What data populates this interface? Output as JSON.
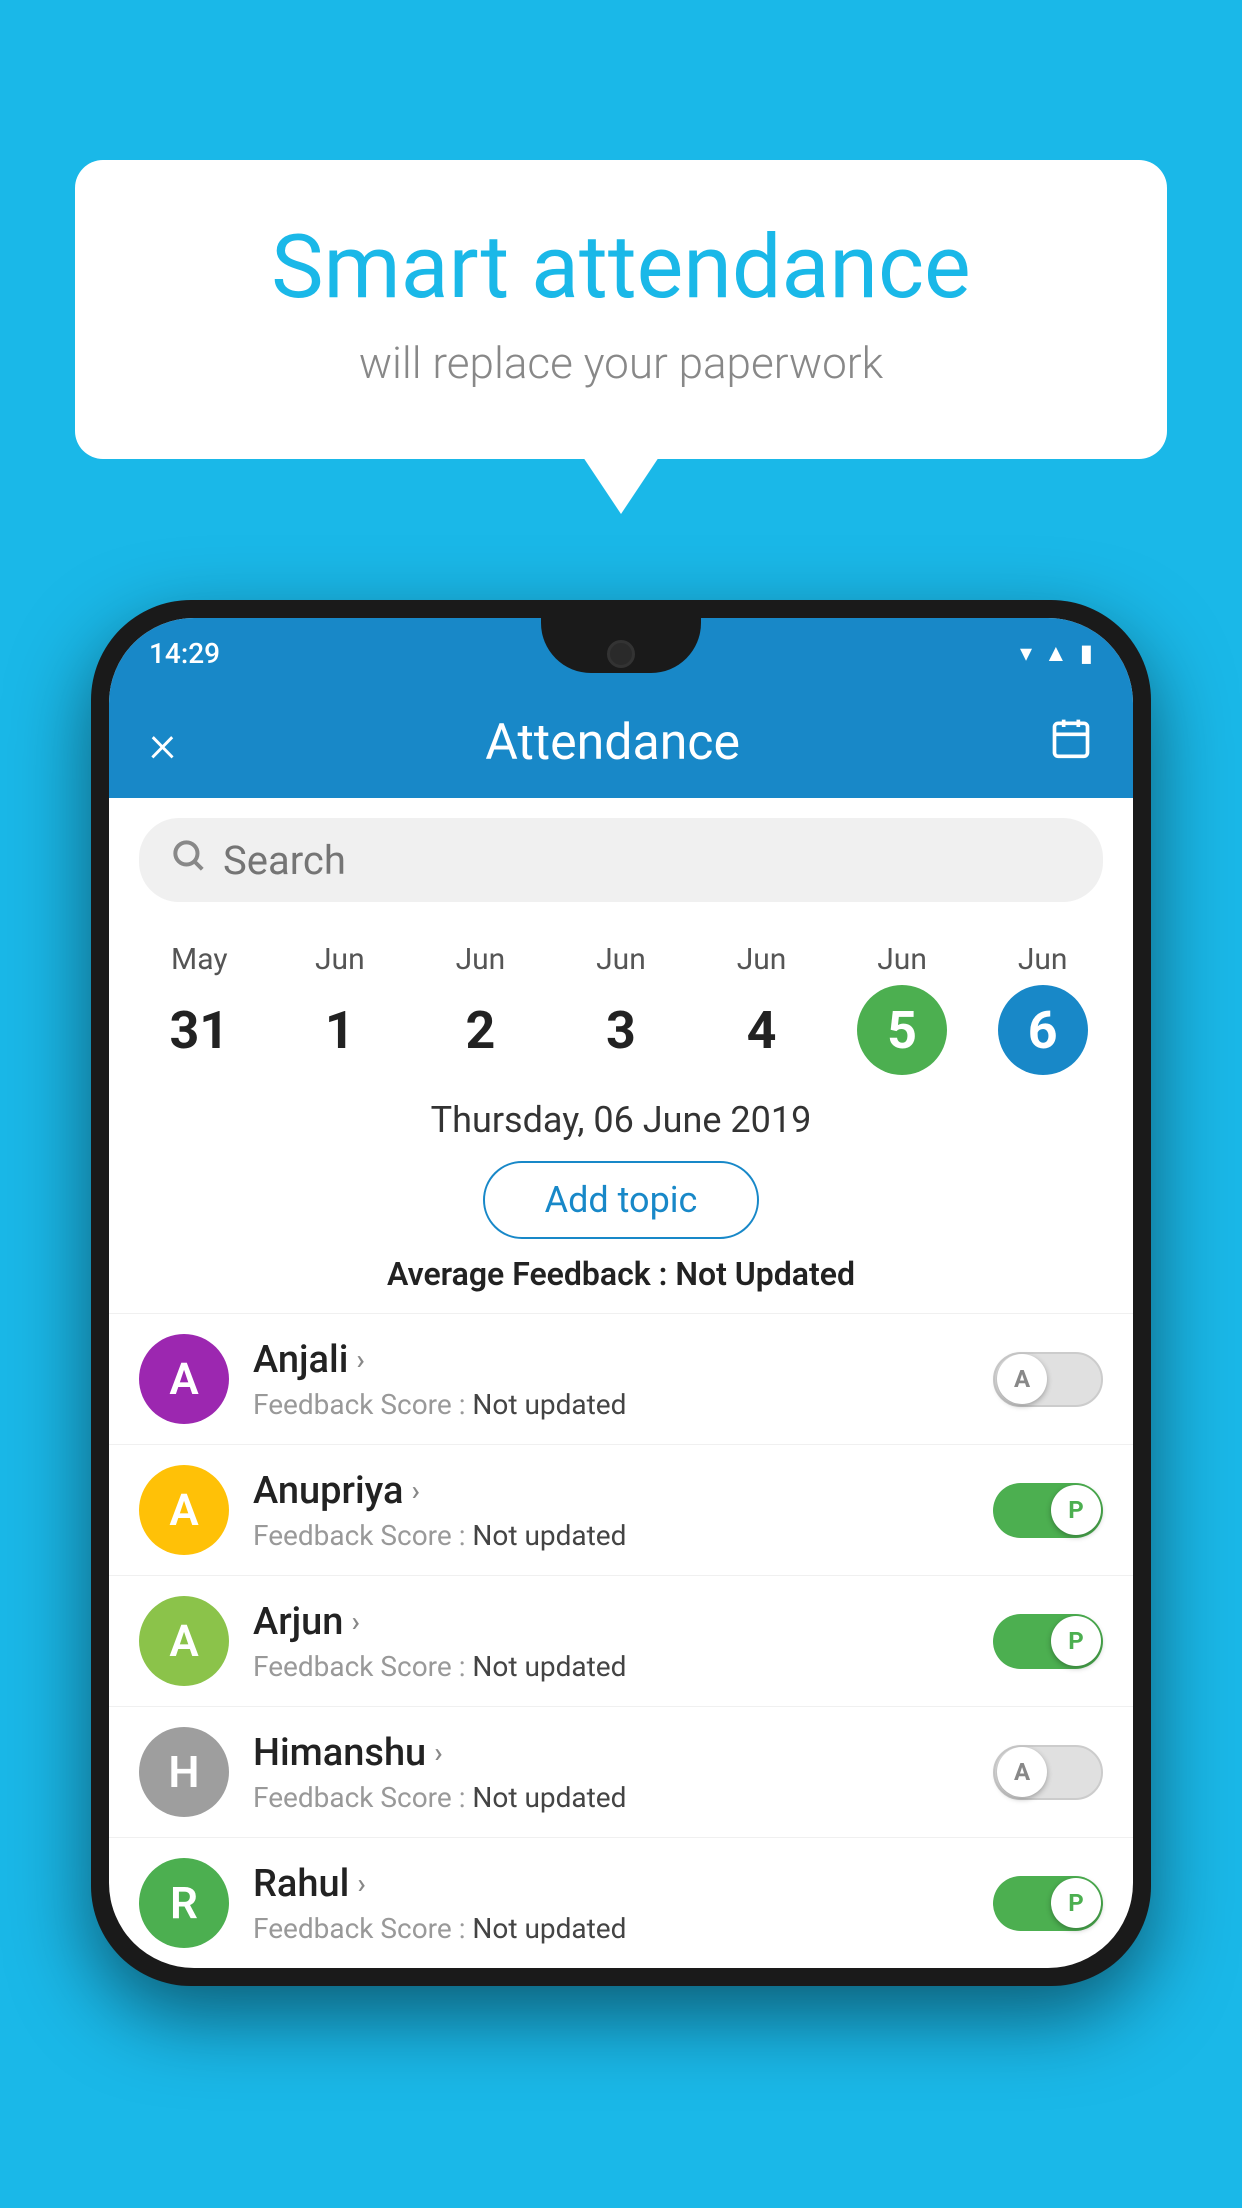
{
  "background_color": "#1ab8e8",
  "speech_bubble": {
    "title": "Smart attendance",
    "subtitle": "will replace your paperwork"
  },
  "status_bar": {
    "time": "14:29",
    "icons": [
      "wifi",
      "signal",
      "battery"
    ]
  },
  "header": {
    "title": "Attendance",
    "close_label": "×",
    "calendar_label": "📅"
  },
  "search": {
    "placeholder": "Search"
  },
  "calendar": {
    "days": [
      {
        "month": "May",
        "date": "31",
        "state": "normal"
      },
      {
        "month": "Jun",
        "date": "1",
        "state": "normal"
      },
      {
        "month": "Jun",
        "date": "2",
        "state": "normal"
      },
      {
        "month": "Jun",
        "date": "3",
        "state": "normal"
      },
      {
        "month": "Jun",
        "date": "4",
        "state": "normal"
      },
      {
        "month": "Jun",
        "date": "5",
        "state": "today"
      },
      {
        "month": "Jun",
        "date": "6",
        "state": "selected"
      }
    ]
  },
  "selected_date": "Thursday, 06 June 2019",
  "add_topic_label": "Add topic",
  "average_feedback_label": "Average Feedback : ",
  "average_feedback_value": "Not Updated",
  "students": [
    {
      "name": "Anjali",
      "avatar_letter": "A",
      "avatar_color": "#9c27b0",
      "feedback_label": "Feedback Score : ",
      "feedback_value": "Not updated",
      "toggle_state": "inactive",
      "toggle_label": "A"
    },
    {
      "name": "Anupriya",
      "avatar_letter": "A",
      "avatar_color": "#ffc107",
      "feedback_label": "Feedback Score : ",
      "feedback_value": "Not updated",
      "toggle_state": "active",
      "toggle_label": "P"
    },
    {
      "name": "Arjun",
      "avatar_letter": "A",
      "avatar_color": "#8bc34a",
      "feedback_label": "Feedback Score : ",
      "feedback_value": "Not updated",
      "toggle_state": "active",
      "toggle_label": "P"
    },
    {
      "name": "Himanshu",
      "avatar_letter": "H",
      "avatar_color": "#9e9e9e",
      "feedback_label": "Feedback Score : ",
      "feedback_value": "Not updated",
      "toggle_state": "inactive",
      "toggle_label": "A"
    },
    {
      "name": "Rahul",
      "avatar_letter": "R",
      "avatar_color": "#4caf50",
      "feedback_label": "Feedback Score : ",
      "feedback_value": "Not updated",
      "toggle_state": "active",
      "toggle_label": "P"
    }
  ]
}
